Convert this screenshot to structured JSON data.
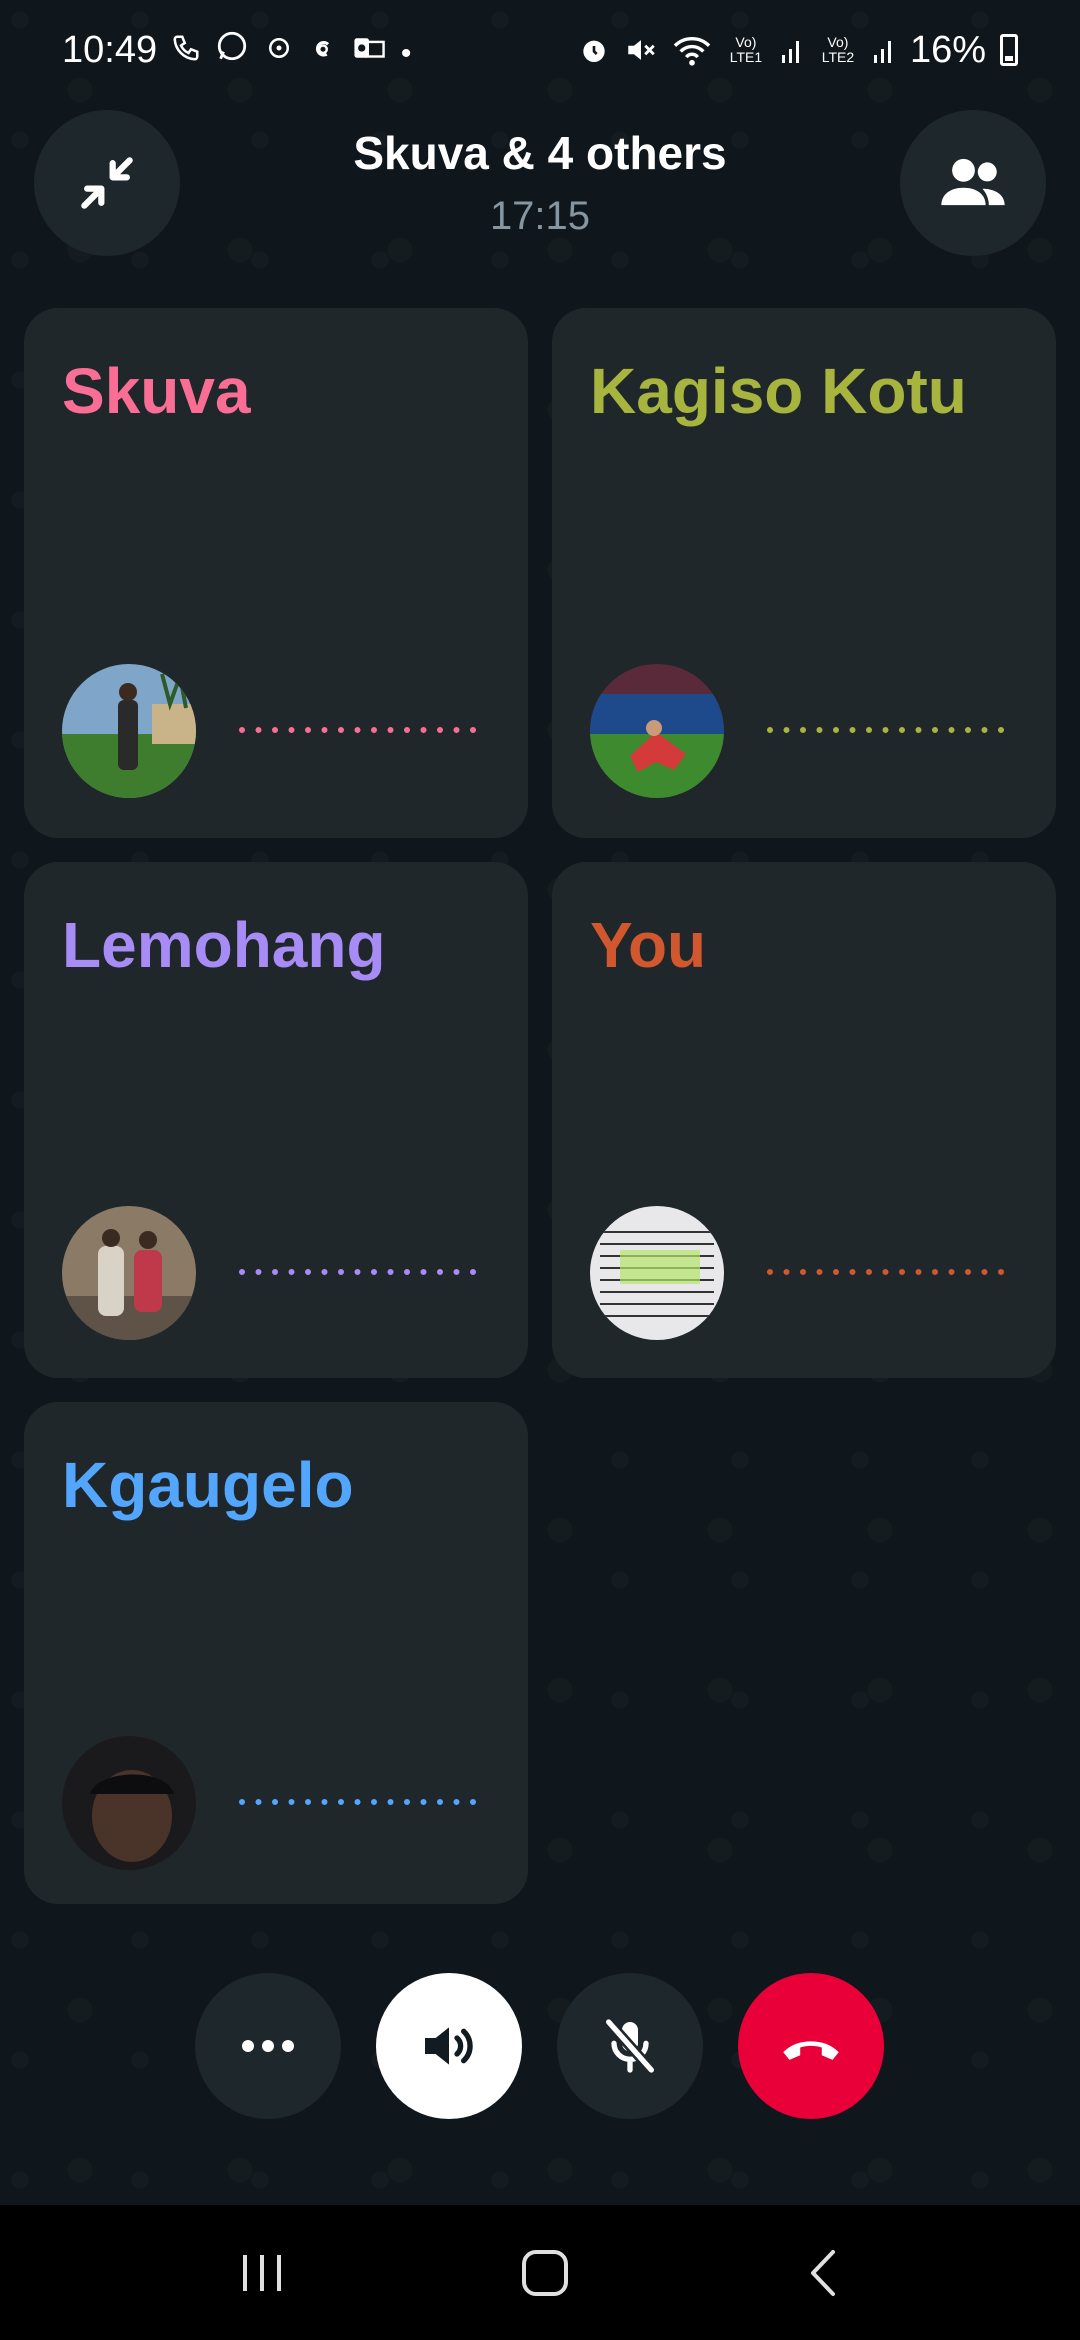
{
  "status_bar": {
    "time": "10:49",
    "left_icons": [
      "phone-icon",
      "whatsapp-icon",
      "notification-icon",
      "threads-icon",
      "outlook-icon",
      "dot-icon"
    ],
    "right_icons": [
      "alarm-icon",
      "mute-icon",
      "wifi-icon",
      "signal-lte1-icon",
      "signal-lte2-icon"
    ],
    "lte1": "Vo) LTE1",
    "lte2": "Vo) LTE2",
    "battery": "16%"
  },
  "header": {
    "title": "Skuva & 4 others",
    "timer": "17:15"
  },
  "participants": [
    {
      "name": "Skuva",
      "color": "#fa6e95"
    },
    {
      "name": "Kagiso Kotu",
      "color": "#a7b43e"
    },
    {
      "name": "Lemohang",
      "color": "#a88cf6"
    },
    {
      "name": "You",
      "color": "#d0572e"
    },
    {
      "name": "Kgaugelo",
      "color": "#53a6fd"
    }
  ],
  "controls": {
    "more": "more-icon",
    "speaker": "speaker-icon",
    "mute": "mic-off-icon",
    "end": "end-call-icon",
    "end_color": "#ea0038"
  },
  "nav_bar": {
    "recents": "recents-icon",
    "home": "home-icon",
    "back": "back-icon"
  }
}
